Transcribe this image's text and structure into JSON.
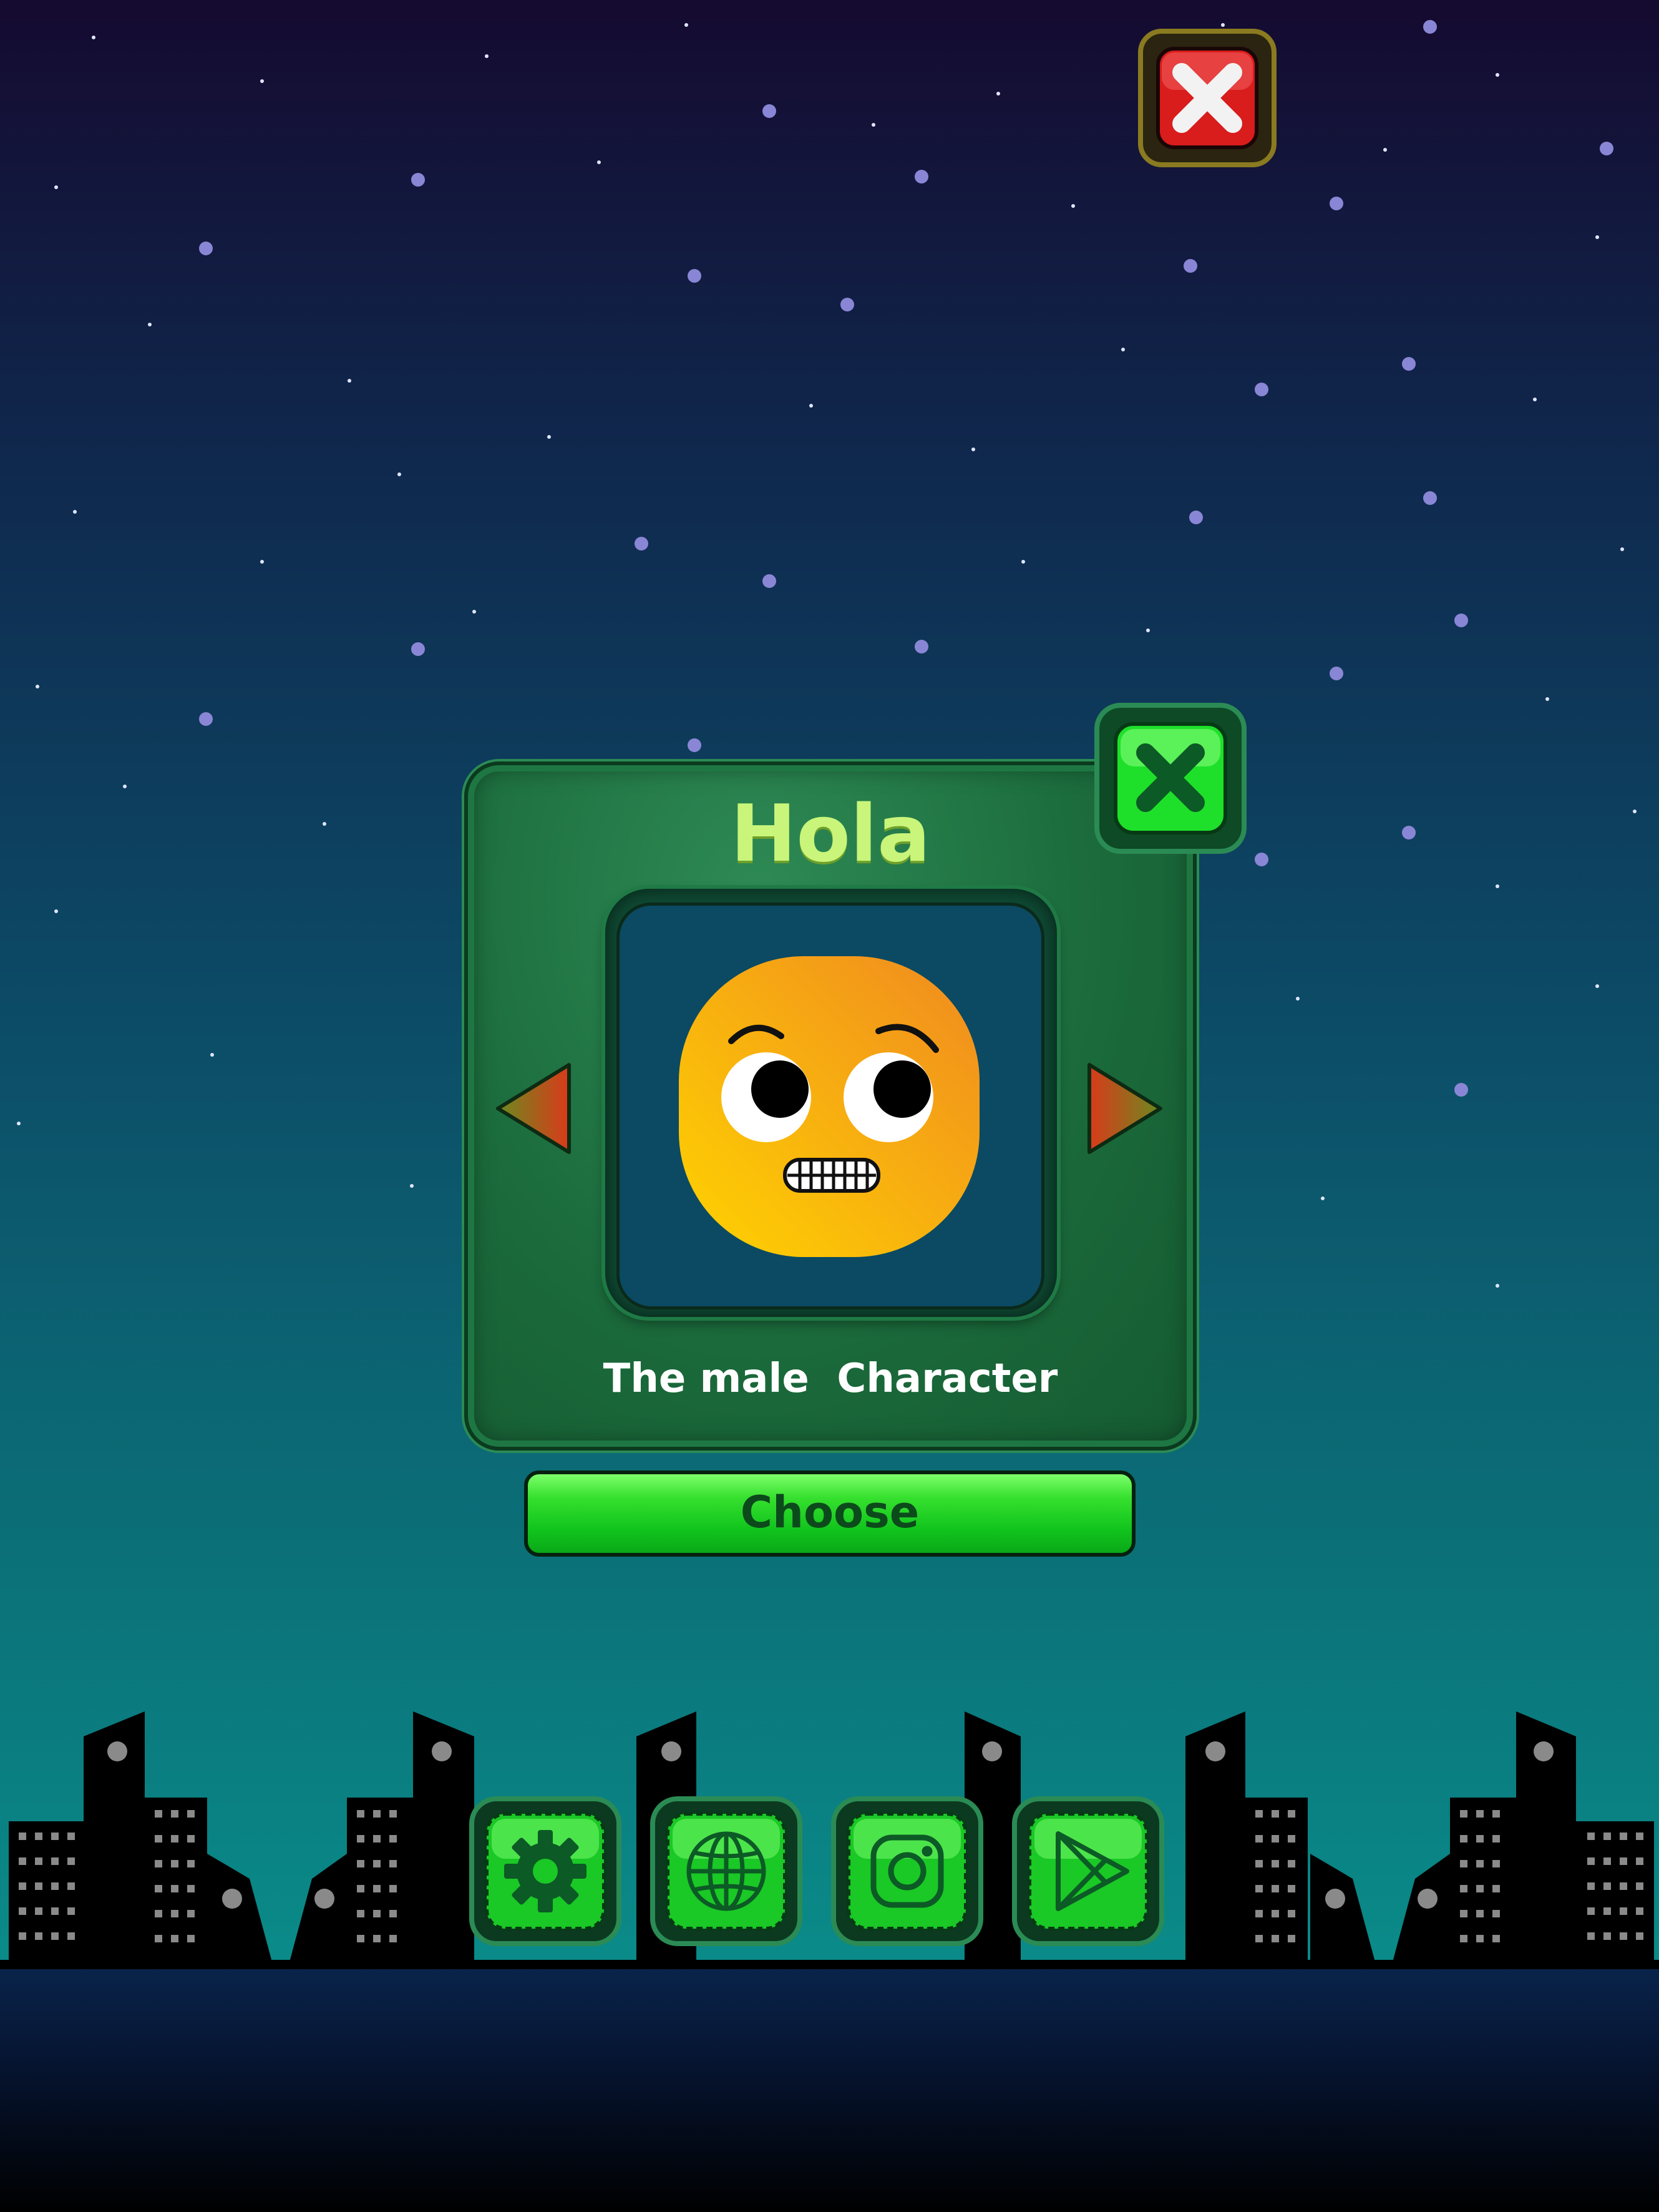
{
  "dialog": {
    "title": "Hola",
    "character_label": "The male  Character",
    "choose_label": "Choose"
  },
  "icons": {
    "top_close": "close-icon",
    "dialog_close": "close-icon",
    "prev": "triangle-left-icon",
    "next": "triangle-right-icon",
    "settings": "gear-icon",
    "language": "globe-icon",
    "social": "instagram-icon",
    "store": "play-store-icon",
    "character": "face-emoji"
  },
  "colors": {
    "panel_green": "#1b6b3c",
    "title": "#c8f57a",
    "button_green": "#11c41d",
    "red_close": "#d91c1c",
    "face_orange": "#f7a81b"
  }
}
